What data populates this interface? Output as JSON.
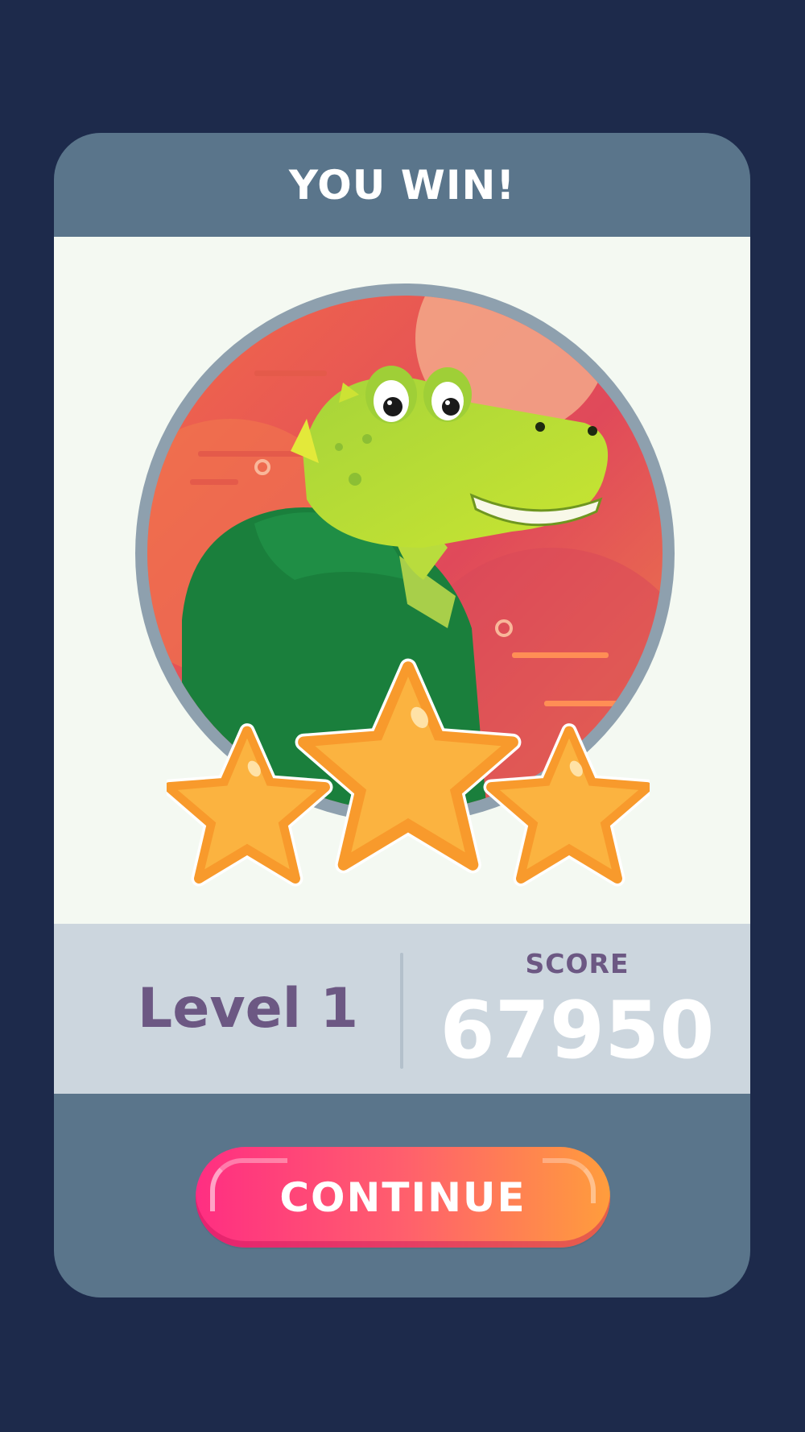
{
  "dialog": {
    "title": "YOU WIN!",
    "level_label": "Level 1",
    "score_label": "SCORE",
    "score_value": "67950",
    "continue_label": "CONTINUE",
    "stars_earned": 3,
    "stars_total": 3
  },
  "icons": {
    "character": "crocodile-in-green-hoodie",
    "star": "star-icon"
  },
  "colors": {
    "background": "#1d2a4b",
    "card": "#5a758b",
    "content": "#f4f9f2",
    "info_panel": "#ccd6de",
    "level_text": "#6c5883",
    "button_start": "#ff2e82",
    "button_end": "#ff9d3c",
    "star": "#fbb03b"
  }
}
